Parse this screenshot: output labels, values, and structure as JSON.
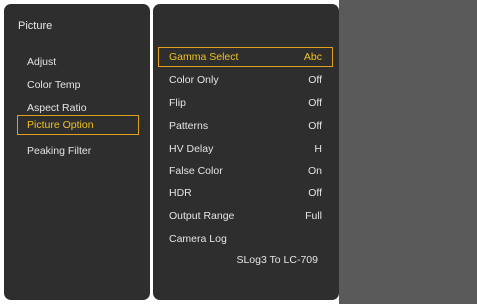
{
  "left_panel": {
    "title": "Picture",
    "items": [
      {
        "label": "Adjust"
      },
      {
        "label": "Color Temp"
      },
      {
        "label": "Aspect Ratio"
      },
      {
        "label": "Picture Option"
      },
      {
        "label": "Peaking Filter"
      }
    ],
    "selected_index": 3
  },
  "right_panel": {
    "options": [
      {
        "label": "Gamma Select",
        "value": "Abc"
      },
      {
        "label": "Color Only",
        "value": "Off"
      },
      {
        "label": "Flip",
        "value": "Off"
      },
      {
        "label": "Patterns",
        "value": "Off"
      },
      {
        "label": "HV Delay",
        "value": "H"
      },
      {
        "label": "False Color",
        "value": "On"
      },
      {
        "label": "HDR",
        "value": "Off"
      },
      {
        "label": "Output Range",
        "value": "Full"
      },
      {
        "label": "Camera Log",
        "value": ""
      }
    ],
    "camera_log_value": "SLog3 To LC-709",
    "selected_index": 0
  },
  "colors": {
    "panel_bg": "#2e2e2e",
    "side_bg": "#5a5a5a",
    "text": "#e4e4e4",
    "highlight_text": "#f0c020",
    "highlight_border": "#e0a020"
  }
}
